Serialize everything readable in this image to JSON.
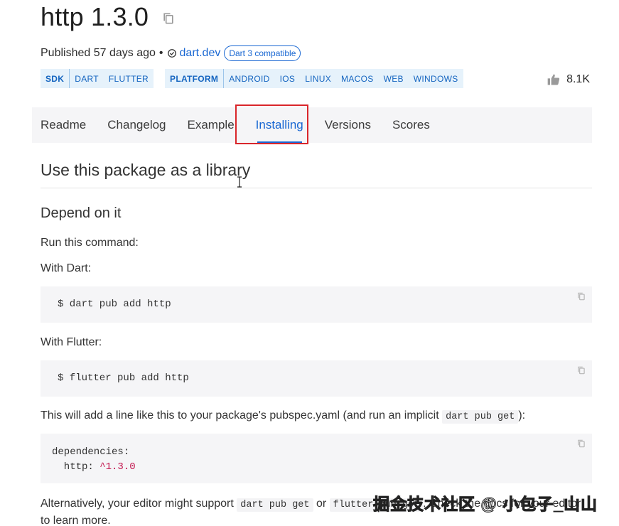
{
  "package": {
    "title": "http 1.3.0",
    "published_label": "Published",
    "published_ago": "57 days ago",
    "separator": "•",
    "publisher": "dart.dev",
    "compat_badge": "Dart 3 compatible"
  },
  "tags": {
    "sdk": {
      "head": "SDK",
      "items": [
        "DART",
        "FLUTTER"
      ]
    },
    "platform": {
      "head": "PLATFORM",
      "items": [
        "ANDROID",
        "IOS",
        "LINUX",
        "MACOS",
        "WEB",
        "WINDOWS"
      ]
    }
  },
  "likes": {
    "count": "8.1K"
  },
  "tabs": {
    "readme": "Readme",
    "changelog": "Changelog",
    "example": "Example",
    "installing": "Installing",
    "versions": "Versions",
    "scores": "Scores",
    "active": "Installing"
  },
  "content": {
    "section_title": "Use this package as a library",
    "depend_title": "Depend on it",
    "run_command": "Run this command:",
    "with_dart": "With Dart:",
    "dart_command": "$ dart pub add http",
    "with_flutter": "With Flutter:",
    "flutter_command": "$ flutter pub add http",
    "add_line_pre": "This will add a line like this to your package's pubspec.yaml (and run an implicit ",
    "add_line_code": "dart pub get",
    "add_line_post": "):",
    "yaml_line1": "dependencies:",
    "yaml_line2_key": "  http: ",
    "yaml_line2_val": "^1.3.0",
    "alt_pre": "Alternatively, your editor might support ",
    "alt_code1": "dart pub get",
    "alt_mid": " or ",
    "alt_code2": "flutter pub get",
    "alt_post": ". Check the docs for your editor",
    "alt_line2": "to learn more."
  },
  "watermark": "掘金技术社区 @ 小包子_山山",
  "colors": {
    "accent": "#1967d2",
    "focus_outline": "#d9262b",
    "tag_bg": "#e6f2fb",
    "code_bg": "#f5f5f7",
    "version_text": "#c3174f"
  },
  "icons": [
    "copy-icon",
    "verified-icon",
    "thumb-up-icon",
    "text-cursor-icon"
  ]
}
